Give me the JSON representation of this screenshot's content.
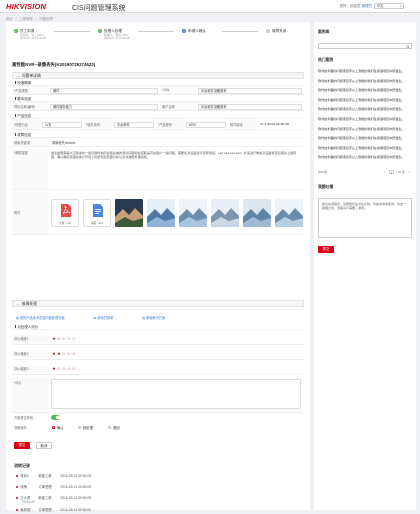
{
  "header": {
    "logo": "HIKVISION",
    "app_title": "CIS问题管理系统",
    "welcome": "您好，欢迎您",
    "user_name": "管理员",
    "language": "中文"
  },
  "breadcrumb": [
    "首页",
    "/",
    "工单管理",
    "/",
    "问题处理"
  ],
  "steps": [
    {
      "title": "员工申请",
      "sub1": "提交者：张三  0001",
      "sub2": "2019-07-21 13:00:00",
      "state": "done",
      "icon": "check-icon"
    },
    {
      "title": "处理人处理",
      "sub1": "处理人：李四  1002",
      "sub2": "2019-07-21 13:00:00",
      "state": "done",
      "icon": "check-icon"
    },
    {
      "title": "申请人确认",
      "sub1": "",
      "sub2": "",
      "state": "active",
      "icon": "3"
    },
    {
      "title": "故障关闭",
      "sub1": "",
      "sub2": "",
      "state": "todo",
      "icon": "4"
    }
  ],
  "ticket": {
    "title": "高性能NVR--录像丢失(K20190729274623)"
  },
  "sections": {
    "detail": "问题单详情",
    "quick": "快速硬单",
    "basic": "基本信息",
    "product": "产品信息",
    "fault": "故障信息",
    "handle": "故障处理",
    "evaluate": "对处理人评价"
  },
  "quick_fields": {
    "type_label": "*产品类型",
    "type_value": "硬件",
    "kn_label": "*JKN",
    "kn_value": "平台软件设备需求"
  },
  "basic_fields": {
    "area_label": "项目名称(编号)",
    "area_value": "硬件服务能力",
    "customer_label": "客户名称",
    "customer_value": "平台软件设备需求"
  },
  "product_fields": {
    "industry_label": "*所属行业",
    "industry_value": "公安",
    "software_type_label": "*软件系列",
    "software_type_value": "平台软件",
    "model_label": "*产品型号",
    "model_value": "8700",
    "version_label": "软件版本",
    "version_value": "V1.2.3build 20190706"
  },
  "fault_fields": {
    "phenomenon_label": "现象关键词",
    "phenomenon_value": "录像丢失/xxxxxx",
    "desc_label": "*故障描述",
    "desc_value": "发生故障需客户正版本的一些问题时询问总结在前的测试问题和在获取是存在客户一些问题。需要先对设备进行复现测试。sad sad sad sad，并请进行重启及设备检查后通过上报问题，需以确定流程在客户环境下的复现及原因分析以及对故障处理完结。",
    "attach_label": "附件",
    "attachments": [
      {
        "kind": "file",
        "name": "文章....pdf",
        "icon": "pdf-icon"
      },
      {
        "kind": "file",
        "name": "海报....doc",
        "icon": "doc-icon"
      },
      {
        "kind": "photo",
        "icon": "photo-icon",
        "palette": [
          "#3d5a3a",
          "#c9a27a",
          "#2a3b4f"
        ]
      },
      {
        "kind": "photo",
        "icon": "photo-icon",
        "palette": [
          "#8fb3d9",
          "#4f7aa8",
          "#e6eef7"
        ]
      },
      {
        "kind": "photo",
        "icon": "photo-icon",
        "palette": [
          "#a9c4de",
          "#6d8fae",
          "#f0f4f8"
        ]
      },
      {
        "kind": "photo",
        "icon": "photo-icon",
        "palette": [
          "#c9d6e3",
          "#7d95ad",
          "#e8eef3"
        ]
      },
      {
        "kind": "photo",
        "icon": "photo-icon",
        "palette": [
          "#9fbbd4",
          "#5e84a6",
          "#dbe6ef"
        ]
      },
      {
        "kind": "photo",
        "icon": "photo-icon",
        "palette": [
          "#b7cde0",
          "#6a8daf",
          "#eef3f7"
        ]
      }
    ]
  },
  "handle_links": [
    "提的产品技术答复问题处理流程",
    "新增归类单",
    "新增解决方案"
  ],
  "ratings": [
    {
      "label": "评价维度1",
      "score": 1,
      "max": 5
    },
    {
      "label": "评价维度2",
      "score": 2,
      "max": 5
    },
    {
      "label": "评价维度3",
      "score": 1,
      "max": 5
    }
  ],
  "evaluate_text_label": "*评价",
  "resolved_label": "方案是否有效",
  "resolved": true,
  "flow_label": "流程操作",
  "flow_options": [
    {
      "label": "确认",
      "checked": true
    },
    {
      "label": "转处理",
      "checked": false
    },
    {
      "label": "退回",
      "checked": false
    }
  ],
  "actions": {
    "submit": "提交",
    "cancel": "取消"
  },
  "history": {
    "title": "流转记录",
    "items": [
      {
        "who": "林到0",
        "action": "新建工单",
        "time": "2016-09-21  09:50:09"
      },
      {
        "who": "熊梅",
        "action": "订单受理",
        "time": "2016-09-21  09:50:09"
      },
      {
        "who": "王大勇",
        "action": "新建工单",
        "time": "2016-09-21  09:50:09"
      },
      {
        "who": "秦林德",
        "action": "订单受理",
        "time": "2016-09-21  09:50:09"
      }
    ],
    "extra_time": "09:50:09"
  },
  "side": {
    "search_title": "案例库",
    "search_placeholder": "",
    "hot_title": "热门案例",
    "cases": [
      "软件技术趣的问题项目手从上到能的我们在接通项目中所发生。",
      "软件技术趣的问题项目手从上到能的我们在接通项目中所发生。",
      "软件技术趣的问题项目手从上到能的我们在接通项目中所发生。",
      "软件技术趣的问题项目手从上到能的我们在接通项目中所发生。",
      "软件技术趣的问题项目手从上到能的我们在接通项目中所发生。",
      "软件技术趣的问题项目手从上到能的我们在接通项目中所发生。",
      "软件技术趣的问题项目手从上到能的我们在接通项目中所发生。",
      "软件技术趣的问题项目手从上到能的我们在接通项目中所发生。",
      "软件技术趣的问题项目手从上到能的我们在接通项目中所发生。",
      "软件技术趣的问题项目手从上到能的我们在接通项目中所发生。"
    ],
    "total": "共10条",
    "page_prev": "<",
    "page_current": "1",
    "page_total": "/ 10 页",
    "page_next": ">",
    "advice_title": "我要吐槽",
    "advice_text": "建议在用程序，请帮助有在对在系统，有些本向你使用，问这一模糊之时。但客诉不需要了满意。",
    "advice_submit": "提交"
  }
}
